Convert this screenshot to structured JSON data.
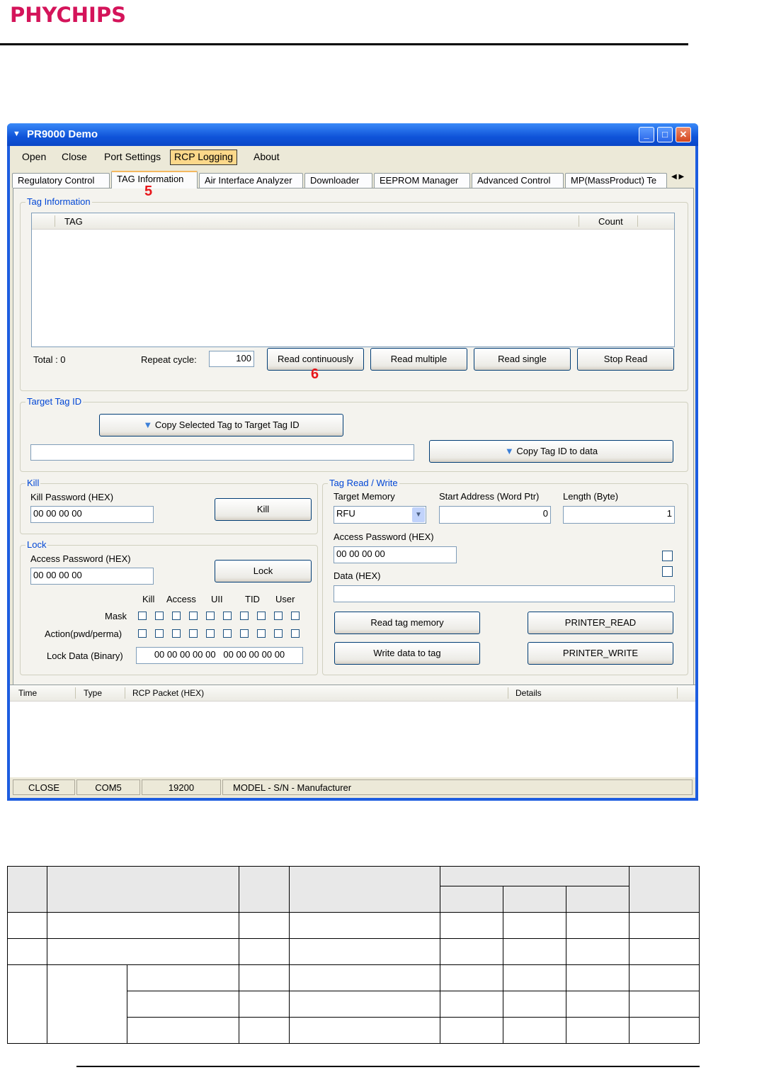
{
  "logo": {
    "text": "PHYCHIPS"
  },
  "window": {
    "title": "PR9000 Demo",
    "minimize": "_",
    "maximize": "□",
    "close": "✕"
  },
  "menu": [
    "Open",
    "Close",
    "Port Settings",
    "RCP Logging",
    "About"
  ],
  "tabs": [
    "Regulatory Control",
    "TAG Information",
    "Air Interface Analyzer",
    "Downloader",
    "EEPROM Manager",
    "Advanced Control",
    "MP(MassProduct) Te"
  ],
  "annotations": {
    "tab_marker": "5",
    "read_marker": "6"
  },
  "tag_info": {
    "group_title": "Tag Information",
    "columns": [
      "TAG",
      "Count"
    ],
    "total_label": "Total : 0",
    "repeat_label": "Repeat cycle:",
    "repeat_value": "100",
    "buttons": [
      "Read continuously",
      "Read multiple",
      "Read single",
      "Stop Read"
    ]
  },
  "target": {
    "group_title": "Target Tag ID",
    "copy_selected": "Copy Selected Tag to Target Tag ID",
    "copy_to_data": "Copy Tag ID to data",
    "field_value": ""
  },
  "kill": {
    "group_title": "Kill",
    "label": "Kill Password (HEX)",
    "value": "00 00 00 00",
    "button": "Kill"
  },
  "lock": {
    "group_title": "Lock",
    "label": "Access Password (HEX)",
    "value": "00 00 00 00",
    "button": "Lock",
    "headers": [
      "Kill",
      "Access",
      "UII",
      "TID",
      "User"
    ],
    "mask_label": "Mask",
    "action_label": "Action(pwd/perma)",
    "lockdata_label": "Lock Data (Binary)",
    "lockdata_value": "00 00 00 00 00   00 00 00 00 00"
  },
  "rw": {
    "group_title": "Tag Read / Write",
    "target_memory_label": "Target Memory",
    "target_memory_value": "RFU",
    "start_label": "Start Address (Word Ptr)",
    "start_value": "0",
    "length_label": "Length (Byte)",
    "length_value": "1",
    "access_label": "Access Password (HEX)",
    "access_value": "00 00 00 00",
    "data_label": "Data (HEX)",
    "data_value": "",
    "buttons": [
      "Read tag memory",
      "PRINTER_READ",
      "Write data to tag",
      "PRINTER_WRITE"
    ]
  },
  "log": {
    "columns": [
      "Time",
      "Type",
      "RCP Packet (HEX)",
      "Details"
    ]
  },
  "status": [
    "CLOSE",
    "COM5",
    "19200",
    "MODEL - S/N - Manufacturer"
  ]
}
